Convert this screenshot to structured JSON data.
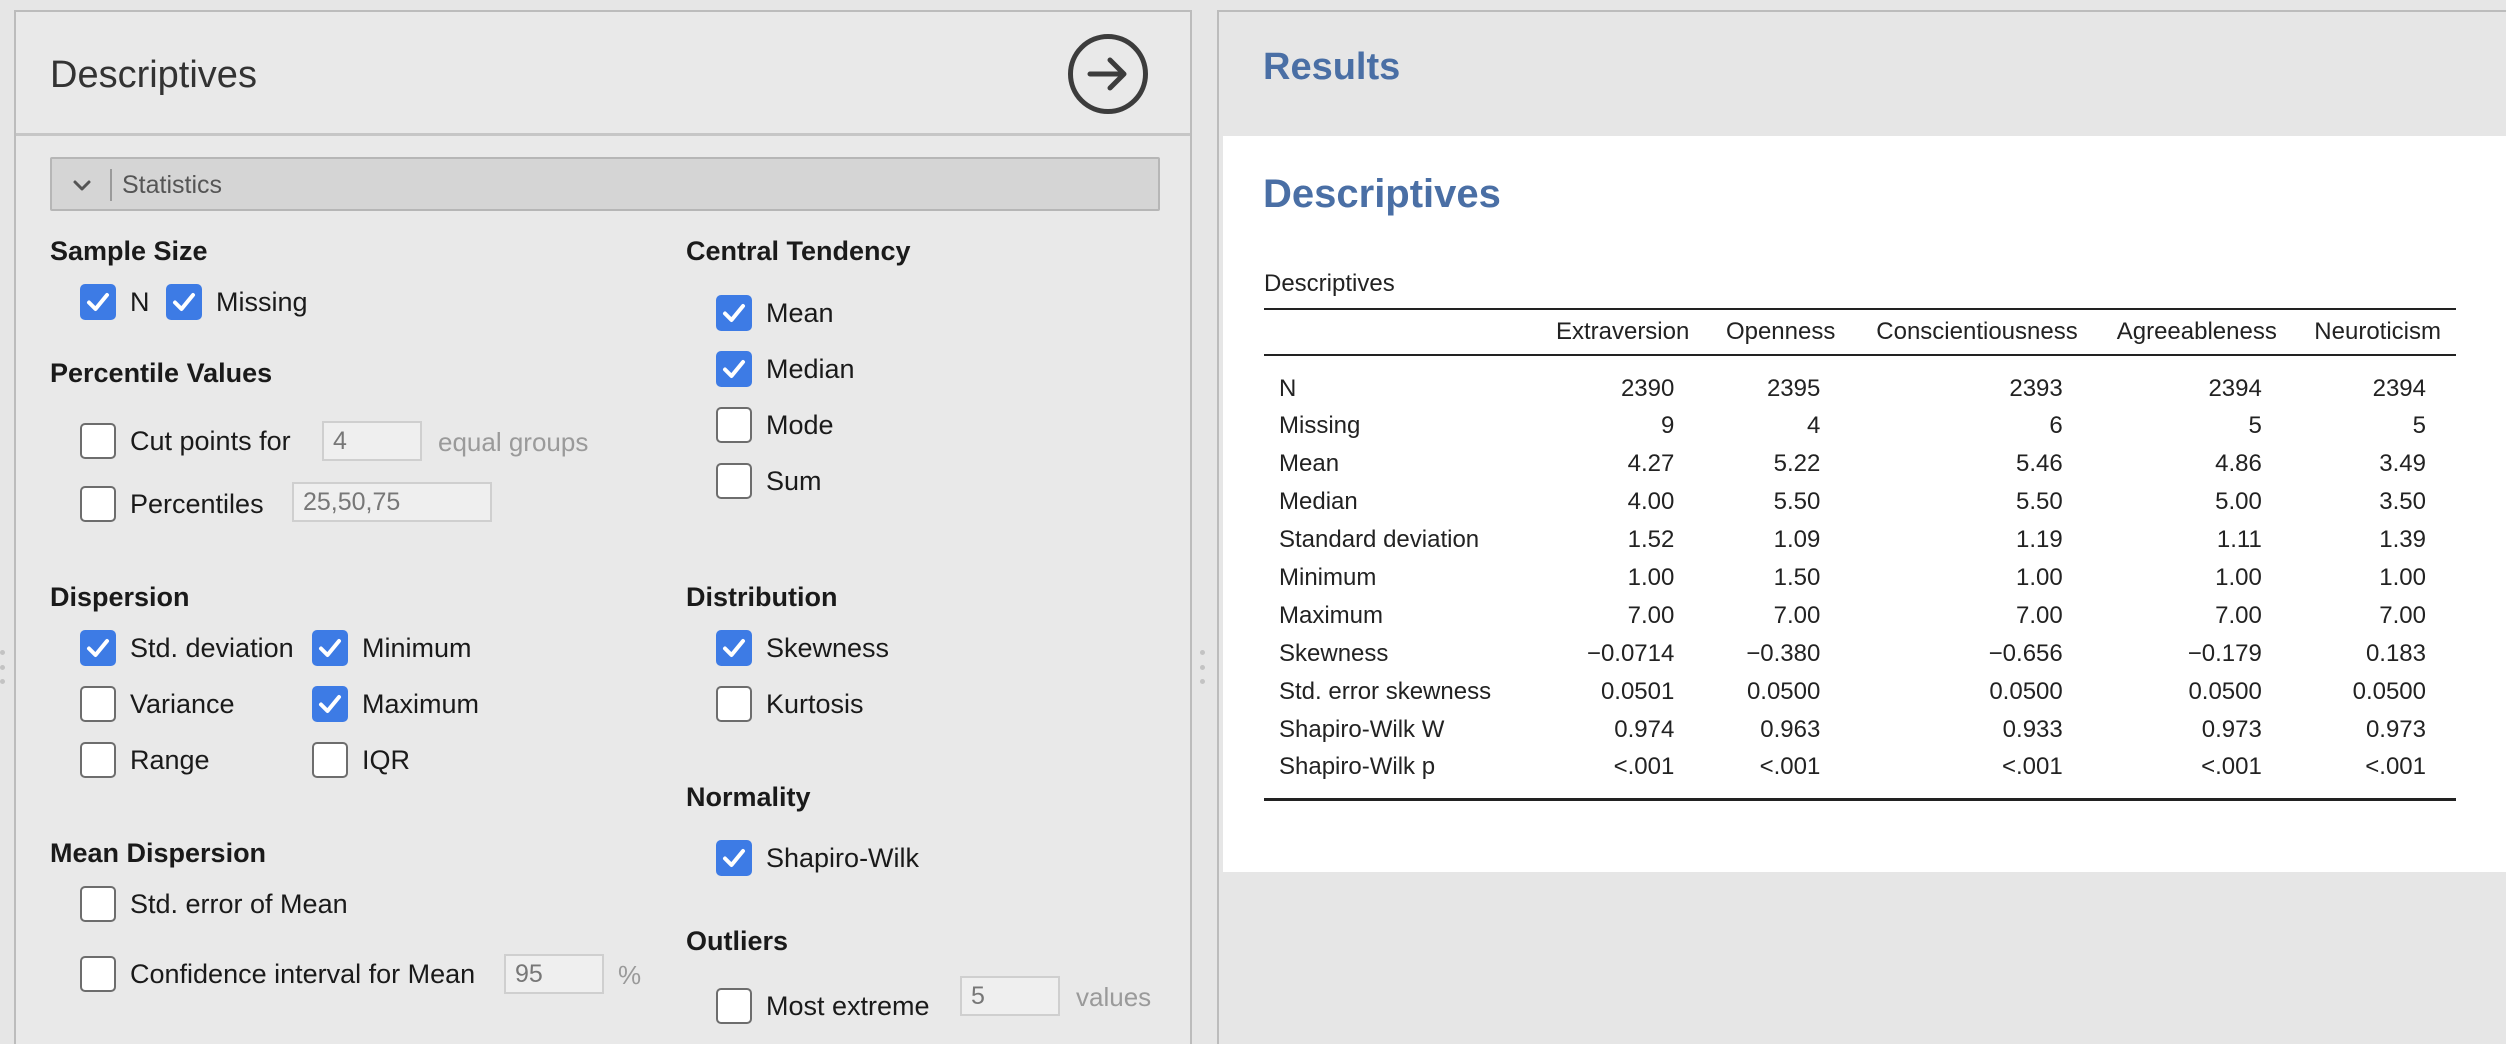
{
  "left": {
    "title": "Descriptives",
    "section_label": "Statistics",
    "groups": {
      "sample_size": "Sample Size",
      "percentile_values": "Percentile Values",
      "dispersion": "Dispersion",
      "mean_dispersion": "Mean Dispersion",
      "central_tendency": "Central Tendency",
      "distribution": "Distribution",
      "normality": "Normality",
      "outliers": "Outliers"
    },
    "options": {
      "n": {
        "label": "N",
        "checked": true
      },
      "missing": {
        "label": "Missing",
        "checked": true
      },
      "cut_points": {
        "label": "Cut points for",
        "checked": false,
        "value": "4",
        "suffix": "equal groups"
      },
      "percentiles": {
        "label": "Percentiles",
        "checked": false,
        "value": "25,50,75"
      },
      "std_deviation": {
        "label": "Std. deviation",
        "checked": true
      },
      "minimum": {
        "label": "Minimum",
        "checked": true
      },
      "variance": {
        "label": "Variance",
        "checked": false
      },
      "maximum": {
        "label": "Maximum",
        "checked": true
      },
      "range": {
        "label": "Range",
        "checked": false
      },
      "iqr": {
        "label": "IQR",
        "checked": false
      },
      "se_mean": {
        "label": "Std. error of Mean",
        "checked": false
      },
      "ci_mean": {
        "label": "Confidence interval for Mean",
        "checked": false,
        "value": "95",
        "suffix": "%"
      },
      "mean": {
        "label": "Mean",
        "checked": true
      },
      "median": {
        "label": "Median",
        "checked": true
      },
      "mode": {
        "label": "Mode",
        "checked": false
      },
      "sum": {
        "label": "Sum",
        "checked": false
      },
      "skewness": {
        "label": "Skewness",
        "checked": true
      },
      "kurtosis": {
        "label": "Kurtosis",
        "checked": false
      },
      "shapiro_wilk": {
        "label": "Shapiro-Wilk",
        "checked": true
      },
      "most_extreme": {
        "label": "Most extreme",
        "checked": false,
        "value": "5",
        "suffix": "values"
      }
    }
  },
  "results": {
    "header": "Results",
    "analysis_title": "Descriptives",
    "table_title": "Descriptives",
    "columns": [
      "",
      "Extraversion",
      "Openness",
      "Conscientiousness",
      "Agreeableness",
      "Neuroticism"
    ],
    "rows": [
      [
        "N",
        "2390",
        "2395",
        "2393",
        "2394",
        "2394"
      ],
      [
        "Missing",
        "9",
        "4",
        "6",
        "5",
        "5"
      ],
      [
        "Mean",
        "4.27",
        "5.22",
        "5.46",
        "4.86",
        "3.49"
      ],
      [
        "Median",
        "4.00",
        "5.50",
        "5.50",
        "5.00",
        "3.50"
      ],
      [
        "Standard deviation",
        "1.52",
        "1.09",
        "1.19",
        "1.11",
        "1.39"
      ],
      [
        "Minimum",
        "1.00",
        "1.50",
        "1.00",
        "1.00",
        "1.00"
      ],
      [
        "Maximum",
        "7.00",
        "7.00",
        "7.00",
        "7.00",
        "7.00"
      ],
      [
        "Skewness",
        "−0.0714",
        "−0.380",
        "−0.656",
        "−0.179",
        "0.183"
      ],
      [
        "Std. error skewness",
        "0.0501",
        "0.0500",
        "0.0500",
        "0.0500",
        "0.0500"
      ],
      [
        "Shapiro-Wilk W",
        "0.974",
        "0.963",
        "0.933",
        "0.973",
        "0.973"
      ],
      [
        "Shapiro-Wilk p",
        "<.001",
        "<.001",
        "<.001",
        "<.001",
        "<.001"
      ]
    ]
  },
  "icons": {
    "run": "arrow-right-circle-icon",
    "collapse": "chevron-down-icon",
    "check": "checkmark-icon"
  },
  "colors": {
    "accent": "#3d7be5",
    "results_title": "#4a6fa5"
  }
}
